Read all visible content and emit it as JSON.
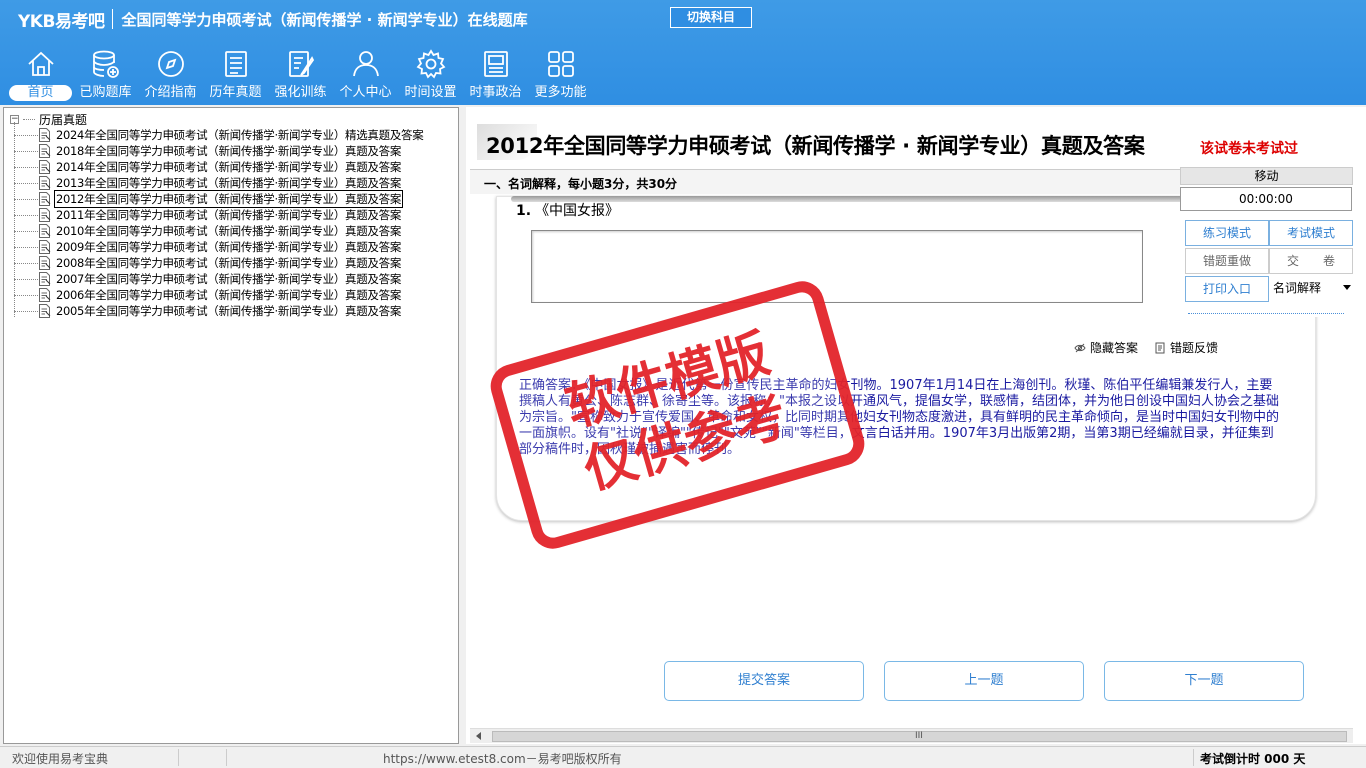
{
  "header": {
    "logo": "YKB易考吧",
    "title": "全国同等学力申硕考试（新闻传播学 · 新闻学专业）在线题库",
    "switch_label": "切换科目"
  },
  "nav": [
    {
      "label": "首页",
      "icon": "home-icon"
    },
    {
      "label": "已购题库",
      "icon": "database-icon"
    },
    {
      "label": "介绍指南",
      "icon": "compass-icon"
    },
    {
      "label": "历年真题",
      "icon": "list-icon"
    },
    {
      "label": "强化训练",
      "icon": "edit-icon"
    },
    {
      "label": "个人中心",
      "icon": "user-icon"
    },
    {
      "label": "时间设置",
      "icon": "gear-icon"
    },
    {
      "label": "时事政治",
      "icon": "book-icon"
    },
    {
      "label": "更多功能",
      "icon": "grid-icon"
    }
  ],
  "tree": {
    "root": "历届真题",
    "items": [
      "2024年全国同等学力申硕考试（新闻传播学·新闻学专业）精选真题及答案",
      "2018年全国同等学力申硕考试（新闻传播学·新闻学专业）真题及答案",
      "2014年全国同等学力申硕考试（新闻传播学·新闻学专业）真题及答案",
      "2013年全国同等学力申硕考试（新闻传播学·新闻学专业）真题及答案",
      "2012年全国同等学力申硕考试（新闻传播学·新闻学专业）真题及答案",
      "2011年全国同等学力申硕考试（新闻传播学·新闻学专业）真题及答案",
      "2010年全国同等学力申硕考试（新闻传播学·新闻学专业）真题及答案",
      "2009年全国同等学力申硕考试（新闻传播学·新闻学专业）真题及答案",
      "2008年全国同等学力申硕考试（新闻传播学·新闻学专业）真题及答案",
      "2007年全国同等学力申硕考试（新闻传播学·新闻学专业）真题及答案",
      "2006年全国同等学力申硕考试（新闻传播学·新闻学专业）真题及答案",
      "2005年全国同等学力申硕考试（新闻传播学·新闻学专业）真题及答案"
    ],
    "selected_index": 4
  },
  "paper": {
    "title": "2012年全国同等学力申硕考试（新闻传播学 · 新闻学专业）真题及答案",
    "not_tested": "该试卷未考试过",
    "section": "一、名词解释，每小题3分，共30分"
  },
  "question": {
    "number": "1.",
    "stem": "《中国女报》",
    "hide_answer": "隐藏答案",
    "feedback": "错题反馈",
    "answer": "正确答案：《中国女报》是近代第一份宣传民主革命的妇女刊物。1907年1月14日在上海创刊。秋瑾、陈伯平任编辑兼发行人，主要撰稿人有黄公、陈志群、徐寄尘等。该报称：\"本报之设以开通风气，提倡女学，联感情，结团体，并为他日创设中国妇人协会之基础为宗旨。\"宣称致力于宣传爱国、革命和女权，比同时期其他妇女刊物态度激进，具有鲜明的民主革命倾向，是当时中国妇女刊物中的一面旗帜。设有\"社说\"\"译编\"\"传记\"\"文苑\"\"新闻\"等栏目，文言白话并用。1907年3月出版第2期，当第3期已经编就目录，并征集到部分稿件时，因秋瑾被捕遇害而停刊。"
  },
  "control": {
    "move": "移动",
    "timer": "00:00:00",
    "practice_mode": "练习模式",
    "exam_mode": "考试模式",
    "redo_wrong": "错题重做",
    "submit_paper": "交　　卷",
    "print": "打印入口",
    "type_select": "名词解释"
  },
  "buttons": {
    "submit": "提交答案",
    "prev": "上一题",
    "next": "下一题"
  },
  "watermark": {
    "line1": "软件模版",
    "line2": "仅供参考"
  },
  "status": {
    "welcome": "欢迎使用易考宝典",
    "site": "https://www.etest8.com－易考吧版权所有",
    "countdown": "考试倒计时 000 天"
  }
}
